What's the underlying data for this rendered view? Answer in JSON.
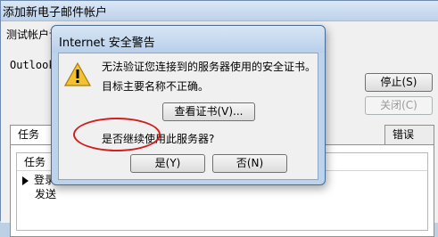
{
  "background_window": {
    "title": "添加新电子邮件帐户",
    "dialog_title": "测试帐户设",
    "outlook_label": "Outlook",
    "stop_button": "停止(S)",
    "close_button": "关闭(C)",
    "tabs": {
      "tasks": "任务",
      "errors": "错误"
    },
    "list": {
      "header": "任务",
      "rows": [
        "登录",
        "发送"
      ]
    }
  },
  "dialog": {
    "title": "Internet 安全警告",
    "icon": "warning-icon",
    "message_line1": "无法验证您连接到的服务器使用的安全证书。",
    "message_line2": "目标主要名称不正确。",
    "view_cert_button": "查看证书(V)...",
    "question": "是否继续使用此服务器?",
    "yes_button": "是(Y)",
    "no_button": "否(N)"
  },
  "colors": {
    "highlight_circle": "#d31d1d"
  }
}
